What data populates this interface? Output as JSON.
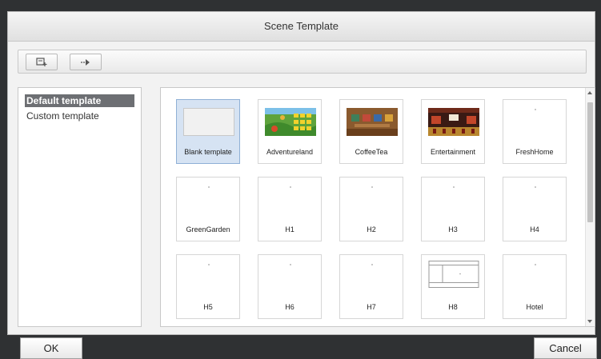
{
  "dialog": {
    "title": "Scene Template"
  },
  "toolbar": {
    "buttons": [
      {
        "icon": "add-template-icon"
      },
      {
        "icon": "arrow-right-icon"
      }
    ]
  },
  "categories": {
    "items": [
      {
        "label": "Default template",
        "selected": true
      },
      {
        "label": "Custom template",
        "selected": false
      }
    ]
  },
  "templates": {
    "items": [
      {
        "label": "Blank template",
        "thumb": "blank",
        "selected": true
      },
      {
        "label": "Adventureland",
        "thumb": "adventureland"
      },
      {
        "label": "CoffeeTea",
        "thumb": "coffeetea"
      },
      {
        "label": "Entertainment",
        "thumb": "entertainment"
      },
      {
        "label": "FreshHome",
        "thumb": "empty"
      },
      {
        "label": "GreenGarden",
        "thumb": "empty"
      },
      {
        "label": "H1",
        "thumb": "empty"
      },
      {
        "label": "H2",
        "thumb": "empty"
      },
      {
        "label": "H3",
        "thumb": "empty"
      },
      {
        "label": "H4",
        "thumb": "empty"
      },
      {
        "label": "H5",
        "thumb": "empty"
      },
      {
        "label": "H6",
        "thumb": "empty"
      },
      {
        "label": "H7",
        "thumb": "empty"
      },
      {
        "label": "H8",
        "thumb": "layout"
      },
      {
        "label": "Hotel",
        "thumb": "empty"
      }
    ]
  },
  "footer": {
    "ok_label": "OK",
    "cancel_label": "Cancel"
  },
  "colors": {
    "selection": "#d6e3f3",
    "category_selected": "#6d6f73",
    "background": "#2f3133"
  }
}
